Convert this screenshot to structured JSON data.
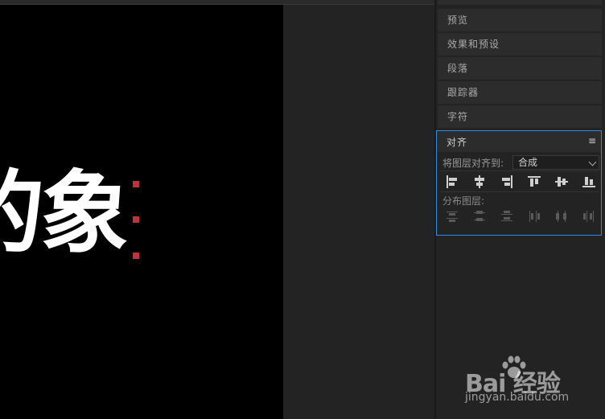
{
  "panels": {
    "tabs": [
      {
        "label": "预览"
      },
      {
        "label": "效果和预设"
      },
      {
        "label": "段落"
      },
      {
        "label": "跟踪器"
      },
      {
        "label": "字符"
      }
    ]
  },
  "align_panel": {
    "title": "对齐",
    "menu_glyph": "≡",
    "align_to_label": "将图层对齐到:",
    "align_to_value": "合成",
    "distribute_label": "分布图层:",
    "align_buttons": [
      "align-left",
      "align-horizontal-center",
      "align-right",
      "align-top",
      "align-vertical-center",
      "align-bottom"
    ],
    "distribute_buttons": [
      "distribute-top",
      "distribute-vertical-center",
      "distribute-bottom",
      "distribute-left",
      "distribute-horizontal-center",
      "distribute-right"
    ]
  },
  "canvas": {
    "text": "的象",
    "handle_color": "#c0323e"
  },
  "colors": {
    "panel_bg": "#232323",
    "tab_bg": "#2c2c2c",
    "focus_border": "#2d8ceb"
  },
  "watermark": {
    "brand": "Bai  经验",
    "url": "jingyan.baidu.com"
  }
}
